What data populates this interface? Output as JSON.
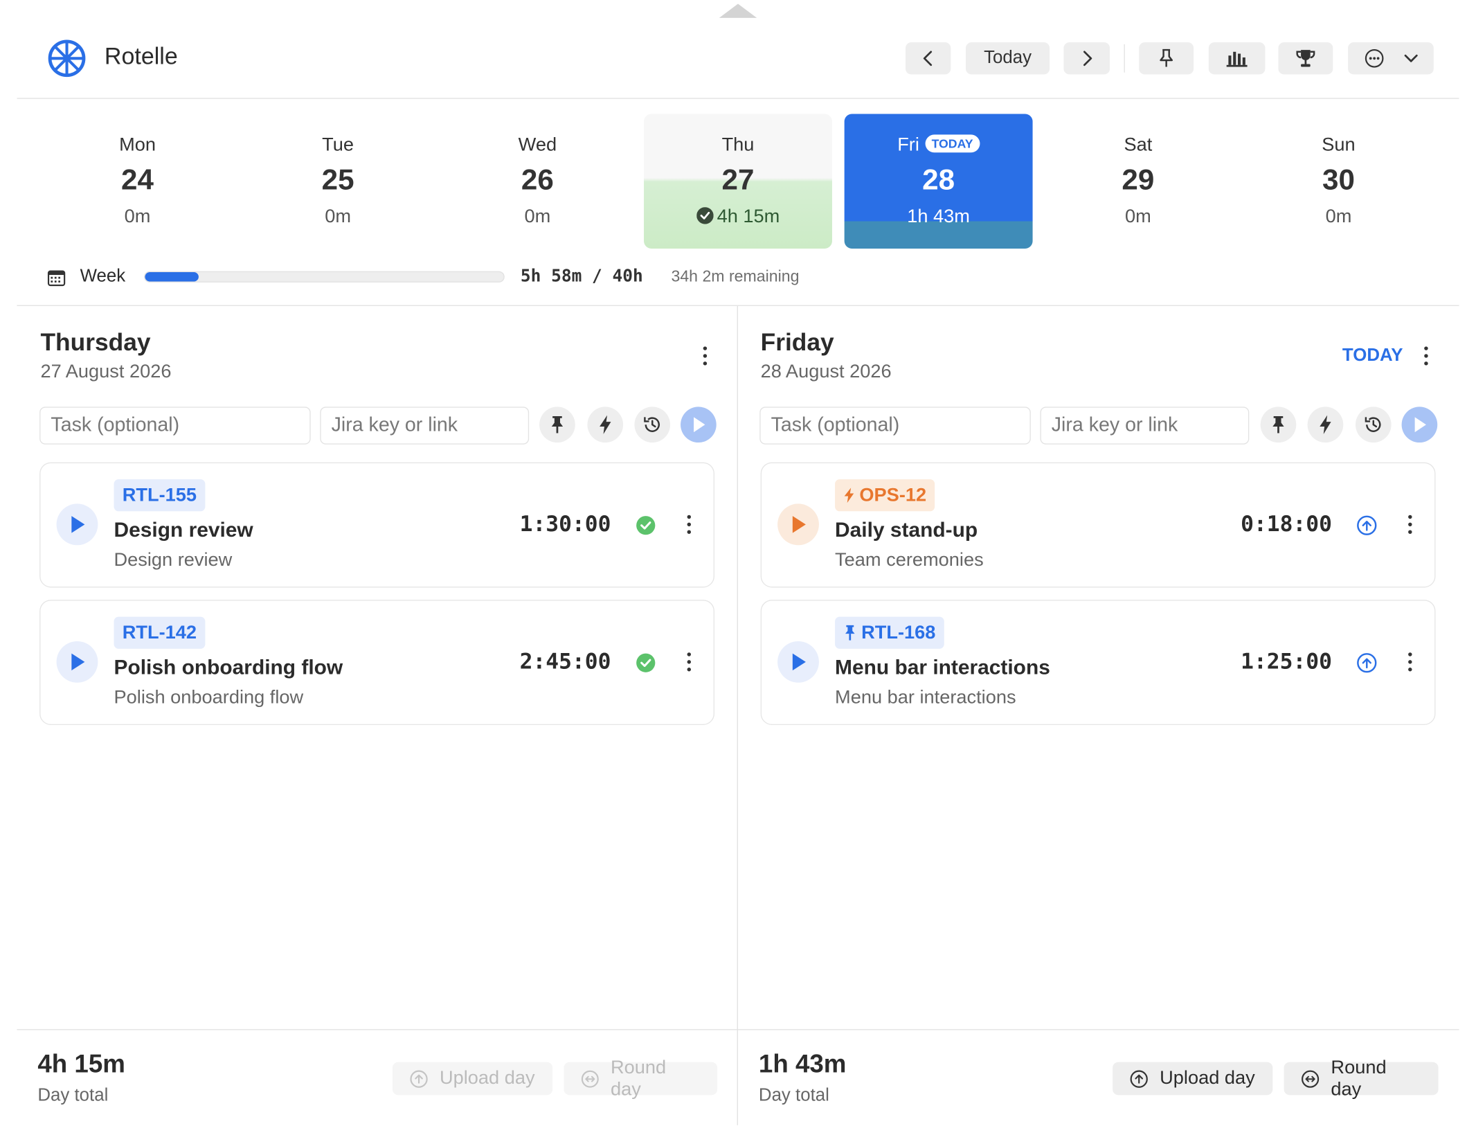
{
  "app": {
    "title": "Rotelle"
  },
  "toolbar": {
    "today_label": "Today"
  },
  "week_days": [
    {
      "name": "Mon",
      "date": "24",
      "total": "0m"
    },
    {
      "name": "Tue",
      "date": "25",
      "total": "0m"
    },
    {
      "name": "Wed",
      "date": "26",
      "total": "0m"
    },
    {
      "name": "Thu",
      "date": "27",
      "total": "4h 15m",
      "status": "complete"
    },
    {
      "name": "Fri",
      "date": "28",
      "total": "1h 43m",
      "badge": "TODAY",
      "selected": true
    },
    {
      "name": "Sat",
      "date": "29",
      "total": "0m"
    },
    {
      "name": "Sun",
      "date": "30",
      "total": "0m"
    }
  ],
  "week_summary": {
    "label": "Week",
    "total": "5h 58m / 40h",
    "remaining": "34h 2m remaining",
    "progress": 0.15
  },
  "panels": [
    {
      "title": "Thursday",
      "date": "27 August 2026",
      "task_placeholder": "Task (optional)",
      "jira_placeholder": "Jira key or link",
      "entries": [
        {
          "key": "RTL-155",
          "name": "Design review",
          "subtitle": "Design review",
          "duration": "1:30:00",
          "status": "done"
        },
        {
          "key": "RTL-142",
          "name": "Polish onboarding flow",
          "subtitle": "Polish onboarding flow",
          "duration": "2:45:00",
          "status": "done"
        }
      ],
      "day_total": "4h 15m",
      "day_total_label": "Day total",
      "upload_label": "Upload day",
      "round_label": "Round day"
    },
    {
      "title": "Friday",
      "date": "28 August 2026",
      "today_label": "TODAY",
      "task_placeholder": "Task (optional)",
      "jira_placeholder": "Jira key or link",
      "entries": [
        {
          "key": "OPS-12",
          "name": "Daily stand-up",
          "subtitle": "Team ceremonies",
          "duration": "0:18:00",
          "status": "upload",
          "tag_icon": "bolt-icon"
        },
        {
          "key": "RTL-168",
          "name": "Menu bar interactions",
          "subtitle": "Menu bar interactions",
          "duration": "1:25:00",
          "status": "upload",
          "tag_icon": "pin-icon"
        }
      ],
      "day_total": "1h 43m",
      "day_total_label": "Day total",
      "upload_label": "Upload day",
      "round_label": "Round day"
    }
  ],
  "colors": {
    "accent": "#2a6fe6",
    "success": "#5cc26b",
    "warning": "#e8772e",
    "complete_day": "#ccebc6"
  }
}
